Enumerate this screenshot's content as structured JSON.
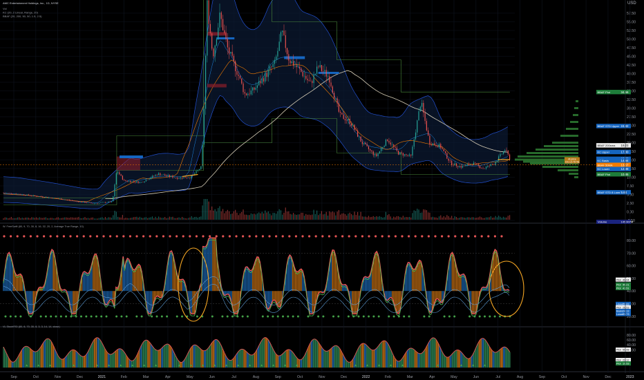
{
  "header": {
    "symbol_title": "AMC Entertainment Holdings, Inc., 1D, NYSE",
    "lines": [
      "Vol",
      "KC (20, 2 Linear, Range, 20)",
      "BBAF (20, 200, 50, 50, 1.5, 2.5)"
    ]
  },
  "price_axis": {
    "unit": "USD",
    "ticks": [
      "57.50",
      "55.00",
      "52.50",
      "50.00",
      "47.50",
      "45.00",
      "42.50",
      "40.00",
      "37.50",
      "35.00",
      "32.50",
      "30.00",
      "27.50",
      "25.00",
      "22.50",
      "20.00",
      "17.50",
      "15.00",
      "12.50",
      "10.00",
      "7.50",
      "5.00",
      "2.50",
      "0.00",
      "-2.50"
    ]
  },
  "price_badges": [
    {
      "text": "BBAF Plot",
      "value": "34.66",
      "color": "#1e7d3a",
      "price": 34.66
    },
    {
      "text": "BBAF STD Upper",
      "value": "24.82",
      "color": "#1565c0",
      "price": 24.82
    },
    {
      "text": "BBAF 200sma",
      "value": "19.23",
      "color": "#eeeeee",
      "price": 19.23
    },
    {
      "text": "KC Upper",
      "value": "17.30",
      "color": "#1565c0",
      "price": 17.3
    },
    {
      "text": "AMC",
      "value": "15.33",
      "color": "#1565c0",
      "price": 15.33
    },
    {
      "text": "KC Basis",
      "value": "14.84",
      "color": "#1565c0",
      "price": 14.84
    },
    {
      "text": "BBAF 50MA",
      "value": "13.57",
      "color": "#f57c00",
      "price": 13.57
    },
    {
      "text": "KC Lower",
      "value": "12.38",
      "color": "#1565c0",
      "price": 12.38
    },
    {
      "text": "BBAF Plot",
      "value": "10.85",
      "color": "#1e7d3a",
      "price": 10.85
    },
    {
      "text": "BBAF STD 8 Lower",
      "value": "5.64",
      "color": "#1565c0",
      "price": 5.64
    }
  ],
  "vol_badge": {
    "text": "Volume",
    "value": "145.907M"
  },
  "vp_label": {
    "line1": "At price",
    "line2": "15.1 (2.76 %)"
  },
  "ind1": {
    "title": "W. FreeSwift (80, 9, 70, 30, 8, 16, 32, 20, 2, Average True Range, 10)",
    "ticks": [
      "80.00",
      "70.00",
      "60.00",
      "50.00",
      "40.00",
      "30.00",
      "20.00"
    ],
    "badges": [
      {
        "text": "Plot",
        "value": "49.04",
        "color": "#eeeeee",
        "val": 49.04
      },
      {
        "text": "Plot",
        "value": "45.21",
        "color": "#1e7d3a",
        "val": 45.21
      },
      {
        "text": "Plot",
        "value": "41.51",
        "color": "#1e7d3a",
        "val": 42.3
      },
      {
        "text": "Upper",
        "value": "29.83",
        "color": "#1565c0",
        "val": 29.83
      },
      {
        "text": "Plot",
        "value": "26.53",
        "color": "#eeeeee",
        "val": 27.1
      },
      {
        "text": "Basis",
        "value": "24.13",
        "color": "#1565c0",
        "val": 24.3
      },
      {
        "text": "Lower",
        "value": "21.73",
        "color": "#1565c0",
        "val": 21.73
      }
    ]
  },
  "ind2": {
    "title": "VL StochRSI (80, 8, 70, 30, 8, 3, 3, 14, 14, close)",
    "ticks": [
      "80.00",
      "60.00",
      "40.00",
      "20.00"
    ],
    "badges": [
      {
        "text": "Plot",
        "value": "50.08",
        "color": "#eeeeee",
        "val": 50.08
      },
      {
        "text": "Plot",
        "value": "23.12",
        "color": "#eeeeee",
        "val": 23.12
      },
      {
        "text": "Plot",
        "value": "19.53",
        "color": "#1e7d3a",
        "val": 19.53
      }
    ]
  },
  "time_axis": [
    "Sep",
    "Oct",
    "Nov",
    "Dec",
    "2021",
    "Feb",
    "Mar",
    "Apr",
    "May",
    "Jun",
    "Jul",
    "Aug",
    "Sep",
    "Oct",
    "Nov",
    "Dec",
    "2022",
    "Feb",
    "Mar",
    "Apr",
    "May",
    "Jun",
    "Jul",
    "Aug",
    "Sep",
    "Oct",
    "Nov",
    "Dec",
    "2023"
  ],
  "colors": {
    "up": "#26a69a",
    "down": "#ef5350",
    "band": "#1e3a66",
    "accent": "#f5a623",
    "bbaf_green": "#2e7d32"
  },
  "chart_data": {
    "type": "line",
    "title": "AMC Entertainment Holdings, Inc., 1D, NYSE",
    "x": [
      "2020-09",
      "2020-10",
      "2020-11",
      "2020-12",
      "2021-01",
      "2021-02",
      "2021-03",
      "2021-04",
      "2021-05",
      "2021-06",
      "2021-07",
      "2021-08",
      "2021-09",
      "2021-10",
      "2021-11",
      "2021-12",
      "2022-01",
      "2022-02",
      "2022-03",
      "2022-04",
      "2022-05",
      "2022-06",
      "2022-07",
      "2022-08"
    ],
    "series": [
      {
        "name": "AMC",
        "values": [
          5.5,
          4.6,
          4.3,
          2.6,
          3.5,
          9.5,
          10.0,
          9.8,
          10.5,
          45,
          44,
          38,
          46,
          40,
          36,
          28,
          21,
          18,
          16,
          26,
          13,
          12,
          13,
          15.33
        ]
      }
    ],
    "ylim": [
      -2.5,
      57.5
    ],
    "xlabel": "",
    "ylabel": "USD"
  }
}
